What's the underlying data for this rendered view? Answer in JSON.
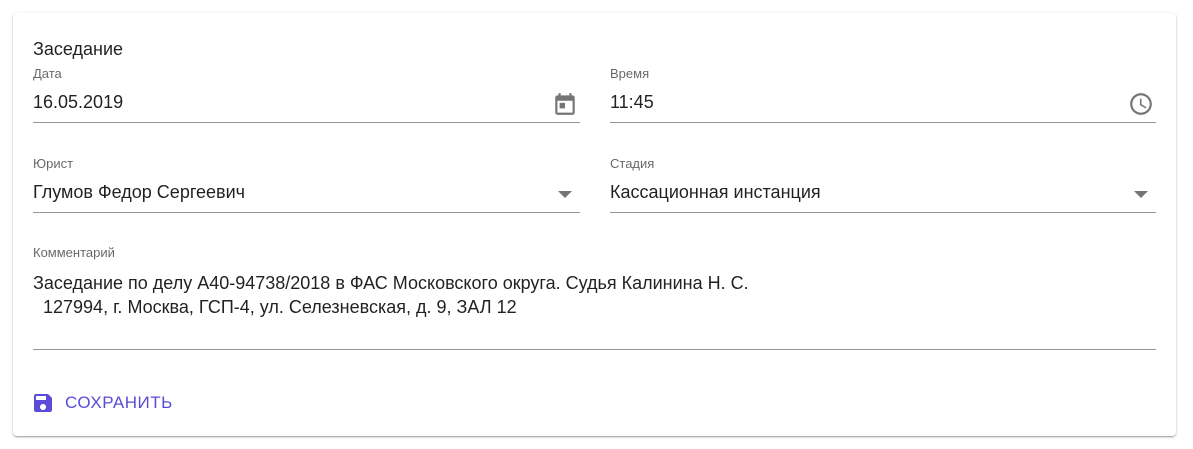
{
  "card": {
    "title": "Заседание"
  },
  "date_field": {
    "label": "Дата",
    "value": "16.05.2019",
    "icon": "calendar-icon"
  },
  "time_field": {
    "label": "Время",
    "value": "11:45",
    "icon": "clock-icon"
  },
  "lawyer_field": {
    "label": "Юрист",
    "value": "Глумов Федор Сергеевич",
    "icon": "dropdown-arrow-icon"
  },
  "stage_field": {
    "label": "Стадия",
    "value": "Кассационная инстанция",
    "icon": "dropdown-arrow-icon"
  },
  "comment_field": {
    "label": "Комментарий",
    "value": "Заседание по делу А40-94738/2018 в ФАС Московского округа. Судья Калинина Н. С.\n  127994, г. Москва, ГСП-4, ул. Селезневская, д. 9, ЗАЛ 12"
  },
  "actions": {
    "save_label": "СОХРАНИТЬ",
    "save_icon": "save-icon"
  },
  "colors": {
    "accent": "#5b4bd8",
    "icon": "#757575"
  }
}
